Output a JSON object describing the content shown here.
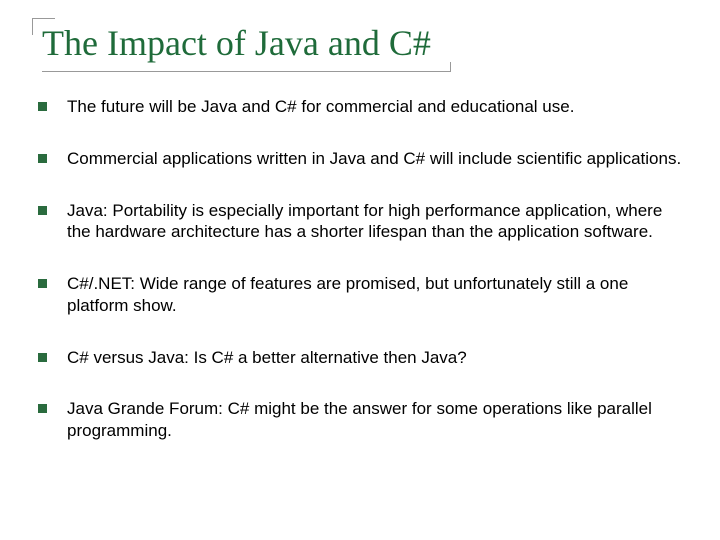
{
  "title": "The Impact of Java and C#",
  "bullets": [
    "The future will be Java and C# for commercial and educational use.",
    "Commercial applications written in Java and C# will include scientific applications.",
    "Java: Portability is especially important for high performance application, where the hardware architecture has a shorter lifespan than the application software.",
    "C#/.NET: Wide range of features are promised, but unfortunately still a one platform show.",
    "C# versus Java: Is C# a better alternative then Java?",
    "Java Grande Forum: C# might be the answer for some operations like parallel programming."
  ],
  "colors": {
    "titleColor": "#1f6b3a",
    "bulletColor": "#2a6b3e",
    "ruleColor": "#999999"
  }
}
